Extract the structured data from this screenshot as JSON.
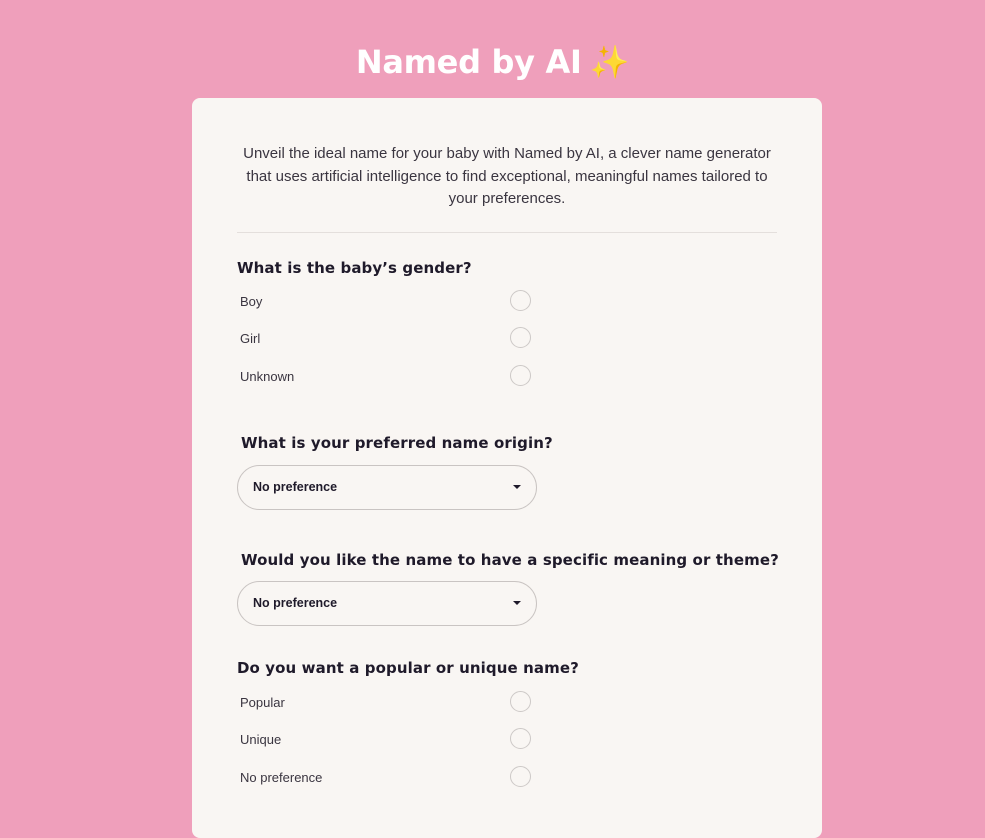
{
  "app": {
    "title": "Named by AI",
    "title_emoji": "✨"
  },
  "intro": "Unveil the ideal name for your baby with Named by AI, a clever name generator that uses artificial intelligence to find exceptional, meaningful names tailored to your preferences.",
  "questions": {
    "gender": {
      "label": "What is the baby’s gender?",
      "options": [
        "Boy",
        "Girl",
        "Unknown"
      ]
    },
    "origin": {
      "label": "What is your preferred name origin?",
      "value": "No preference"
    },
    "meaning": {
      "label": "Would you like the name to have a specific meaning or theme?",
      "value": "No preference"
    },
    "popularity": {
      "label": "Do you want a popular or unique name?",
      "options": [
        "Popular",
        "Unique",
        "No preference"
      ]
    }
  },
  "colors": {
    "background": "#ef9fbb",
    "card": "#f9f6f3",
    "text": "#1f1a2a",
    "muted_text": "#3a3540",
    "border": "#c9c4c2"
  }
}
